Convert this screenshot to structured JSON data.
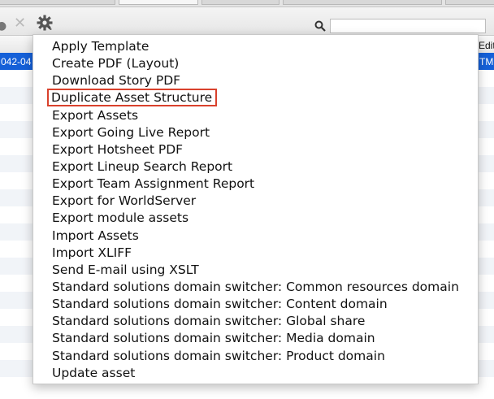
{
  "toolbar": {
    "delete_icon": "close-icon",
    "actions_icon": "gear-icon",
    "search_icon": "search-icon",
    "search_value": "",
    "search_placeholder": ""
  },
  "table": {
    "edit_column_header": "Edit",
    "selected_row": {
      "date_fragment": "042-04",
      "ghost_text": "",
      "edit_fragment": "TM"
    }
  },
  "menu": {
    "items": [
      {
        "label": "Apply Template"
      },
      {
        "label": "Create PDF (Layout)"
      },
      {
        "label": "Download Story PDF"
      },
      {
        "label": "Duplicate Asset Structure",
        "highlighted": true
      },
      {
        "label": "Export Assets"
      },
      {
        "label": "Export Going Live Report"
      },
      {
        "label": "Export Hotsheet PDF"
      },
      {
        "label": "Export Lineup Search Report"
      },
      {
        "label": "Export Team Assignment Report"
      },
      {
        "label": "Export for WorldServer"
      },
      {
        "label": "Export module assets"
      },
      {
        "label": "Import Assets"
      },
      {
        "label": "Import XLIFF"
      },
      {
        "label": "Send E-mail using XSLT"
      },
      {
        "label": "Standard solutions domain switcher: Common resources domain"
      },
      {
        "label": "Standard solutions domain switcher: Content domain"
      },
      {
        "label": "Standard solutions domain switcher: Global share"
      },
      {
        "label": "Standard solutions domain switcher: Media domain"
      },
      {
        "label": "Standard solutions domain switcher: Product domain"
      },
      {
        "label": "Update asset"
      }
    ]
  },
  "colors": {
    "selection": "#1560d8",
    "highlight_outline": "#d9412c"
  }
}
